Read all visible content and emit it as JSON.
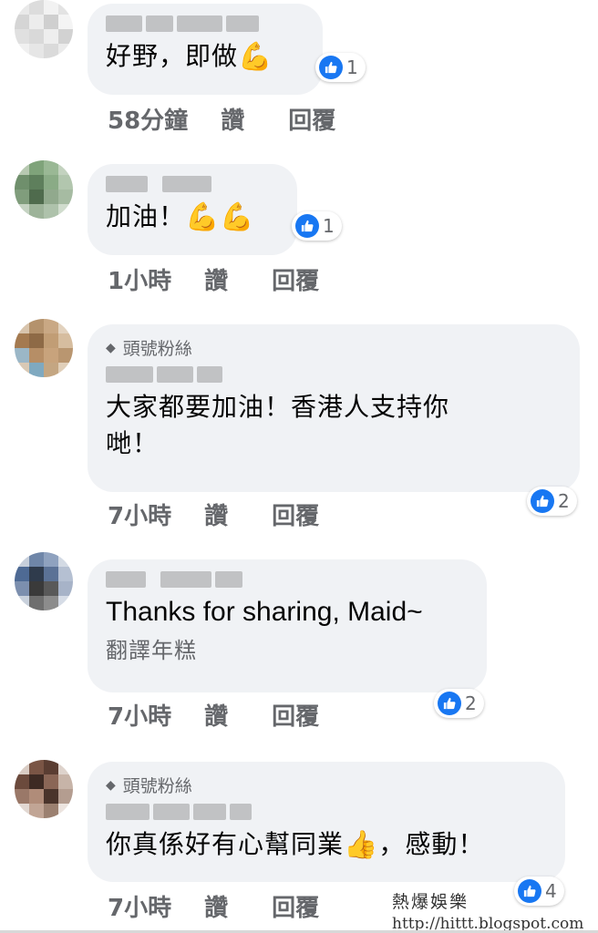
{
  "comments": [
    {
      "text": "好野，即做",
      "emoji": "💪",
      "time": "58分鐘",
      "like": "讚",
      "reply": "回覆",
      "reaction_count": "1"
    },
    {
      "text": "加油！",
      "emoji": "💪💪",
      "time": "1小時",
      "like": "讚",
      "reply": "回覆",
      "reaction_count": "1"
    },
    {
      "badge": "頭號粉絲",
      "text_line1": "大家都要加油！香港人支持你",
      "text_line2": "哋！",
      "time": "7小時",
      "like": "讚",
      "reply": "回覆",
      "reaction_count": "2"
    },
    {
      "text": "Thanks for sharing, Maid~",
      "translate": "翻譯年糕",
      "time": "7小時",
      "like": "讚",
      "reply": "回覆",
      "reaction_count": "2"
    },
    {
      "badge": "頭號粉絲",
      "text": "你真係好有心幫同業",
      "emoji": "👍",
      "text_after": "，感動！",
      "time": "7小時",
      "like": "讚",
      "reply": "回覆",
      "reaction_count": "4"
    }
  ],
  "watermark": {
    "title": "熱爆娛樂",
    "url": "http://hittt.blogspot.com"
  },
  "colors": {
    "bubble": "#f0f2f5",
    "meta_text": "#65676b",
    "like_blue": "#1877f2"
  }
}
